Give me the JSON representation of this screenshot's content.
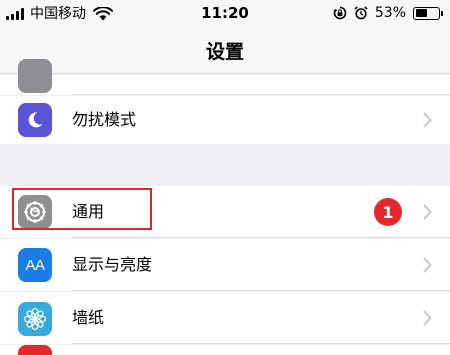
{
  "status_bar": {
    "carrier": "中国移动",
    "time": "11:20",
    "battery_percent": "53%",
    "battery_level": 0.53,
    "icons": [
      "signal-icon",
      "wifi-icon",
      "rotation-lock-icon",
      "alarm-icon",
      "battery-icon"
    ]
  },
  "nav": {
    "title": "设置"
  },
  "rows": {
    "do_not_disturb": {
      "label": "勿扰模式",
      "icon": "moon-icon",
      "icon_color": "#5856d6"
    },
    "general": {
      "label": "通用",
      "icon": "gear-icon",
      "icon_color": "#8e8e93",
      "badge": "1",
      "badge_color": "#e6272c"
    },
    "display": {
      "label": "显示与亮度",
      "icon": "text-size-icon",
      "icon_glyph": "AA",
      "icon_color": "#1a7de3"
    },
    "wallpaper": {
      "label": "墙纸",
      "icon": "flower-icon",
      "icon_color": "#36aadc"
    }
  }
}
